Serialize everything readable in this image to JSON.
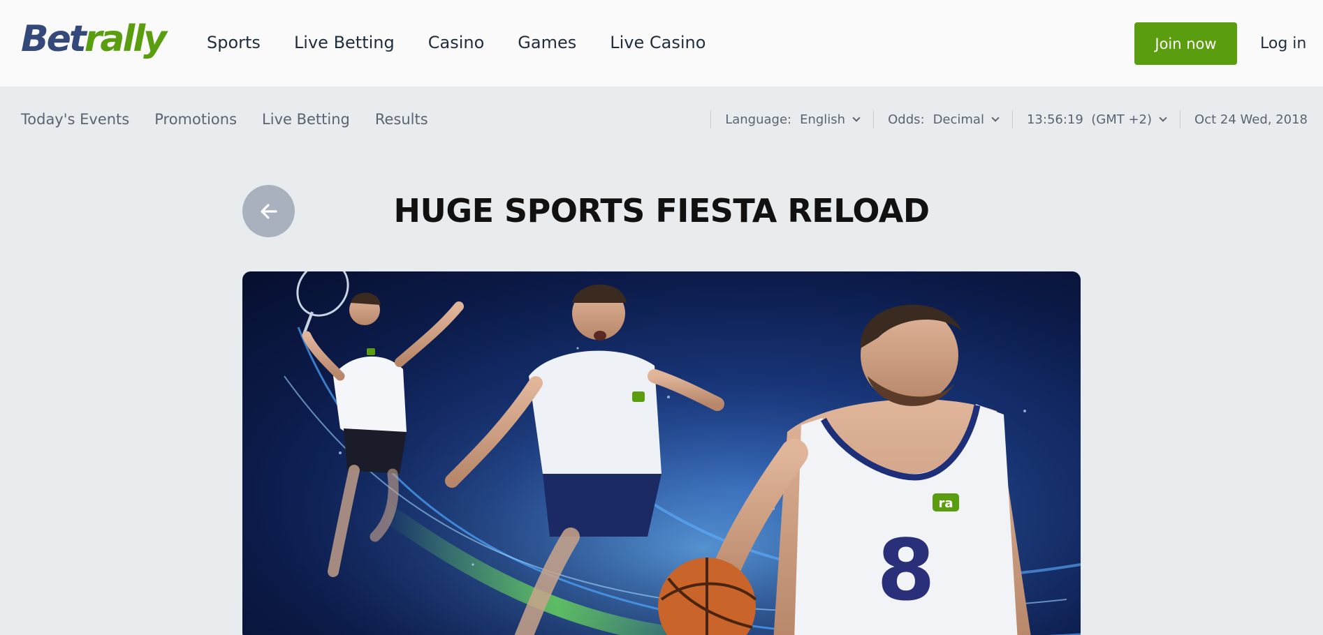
{
  "header": {
    "logo": {
      "part1": "Bet",
      "part2": "rally"
    },
    "nav": [
      "Sports",
      "Live Betting",
      "Casino",
      "Games",
      "Live Casino"
    ],
    "join_label": "Join now",
    "login_label": "Log in"
  },
  "subnav": {
    "links": [
      "Today's Events",
      "Promotions",
      "Live Betting",
      "Results"
    ],
    "language": {
      "label": "Language:",
      "value": "English"
    },
    "odds": {
      "label": "Odds:",
      "value": "Decimal"
    },
    "time": {
      "value": "13:56:19  (GMT +2)"
    },
    "date": "Oct 24 Wed, 2018"
  },
  "promo": {
    "title": "HUGE SPORTS FIESTA RELOAD",
    "jersey_number": "8",
    "jersey_badge": "ra"
  },
  "colors": {
    "brand_blue": "#34497a",
    "brand_green": "#5a9e0f",
    "page_bg": "#e9ecef",
    "header_bg": "#fafafa"
  },
  "icons": {
    "back": "arrow-left-icon",
    "dropdown": "chevron-down-icon"
  }
}
